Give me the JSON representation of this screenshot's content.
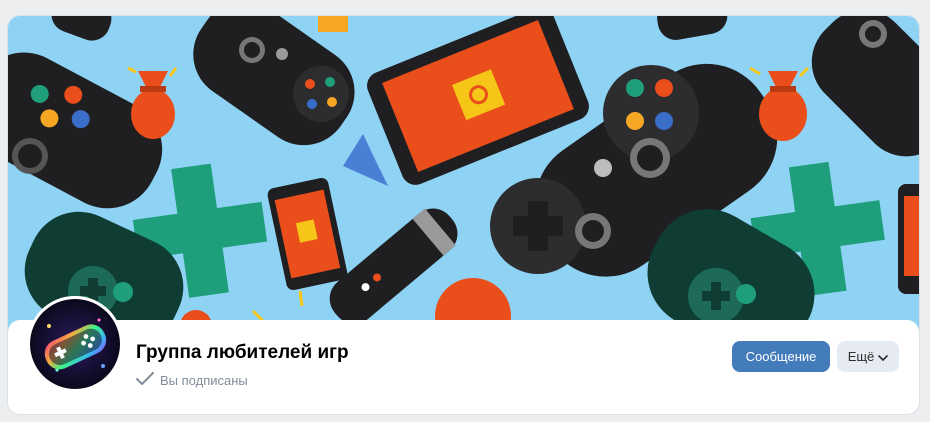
{
  "group": {
    "name": "Группа любителей игр",
    "subscription_status": "Вы подписаны"
  },
  "actions": {
    "message_label": "Сообщение",
    "more_label": "Ещё"
  },
  "colors": {
    "cover_background": "#8fd3f4",
    "primary_button": "#447bba",
    "secondary_button": "#e5ebf1"
  }
}
